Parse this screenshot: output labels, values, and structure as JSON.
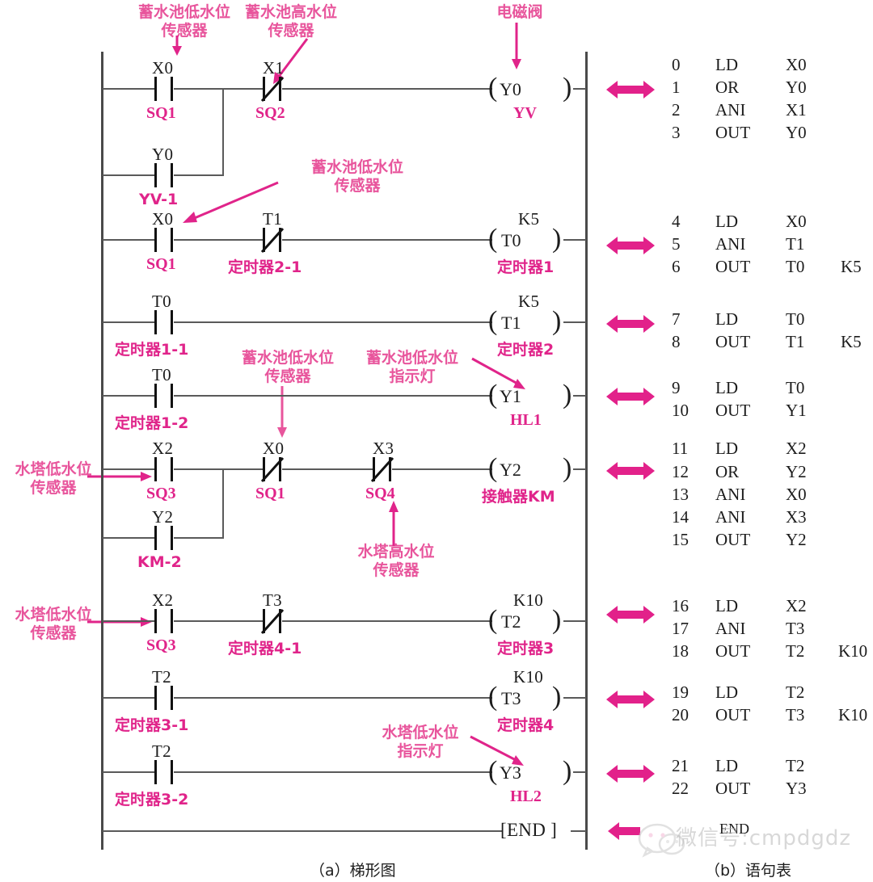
{
  "figure": {
    "caption_a": "（a）梯形图",
    "caption_b": "（b）语句表"
  },
  "annotations": [
    {
      "id": "ann-cistern-low-1",
      "text_l1": "蓄水池低水位",
      "text_l2": "传感器",
      "target": "X0 (rung1)"
    },
    {
      "id": "ann-cistern-high",
      "text_l1": "蓄水池高水位",
      "text_l2": "传感器",
      "target": "X1 (rung1)"
    },
    {
      "id": "ann-solenoid",
      "text_l1": "电磁阀",
      "text_l2": "",
      "target": "Y0 coil"
    },
    {
      "id": "ann-cistern-low-2",
      "text_l1": "蓄水池低水位",
      "text_l2": "传感器",
      "target": "X0 (rung2)"
    },
    {
      "id": "ann-cistern-low-3",
      "text_l1": "蓄水池低水位",
      "text_l2": "传感器",
      "target": "X0 (rung5)"
    },
    {
      "id": "ann-cistern-low-lamp",
      "text_l1": "蓄水池低水位",
      "text_l2": "指示灯",
      "target": "Y1 coil"
    },
    {
      "id": "ann-tower-low-1",
      "text_l1": "水塔低水位",
      "text_l2": "传感器",
      "target": "X2 (rung5)"
    },
    {
      "id": "ann-tower-high",
      "text_l1": "水塔高水位",
      "text_l2": "传感器",
      "target": "X3 (rung5)"
    },
    {
      "id": "ann-tower-low-2",
      "text_l1": "水塔低水位",
      "text_l2": "传感器",
      "target": "X2 (rung6)"
    },
    {
      "id": "ann-tower-low-lamp",
      "text_l1": "水塔低水位",
      "text_l2": "指示灯",
      "target": "Y3 coil"
    }
  ],
  "ladder": {
    "rungs": [
      {
        "id": "rung-1",
        "branches": [
          {
            "contacts": [
              {
                "device": "X0",
                "tag": "SQ1",
                "type": "no"
              }
            ]
          },
          {
            "contacts": [
              {
                "device": "Y0",
                "tag": "YV-1",
                "type": "no"
              }
            ]
          }
        ],
        "series_after_branch": [
          {
            "device": "X1",
            "tag": "SQ2",
            "type": "nc"
          }
        ],
        "coil": {
          "device": "Y0",
          "tag": "YV",
          "preset": "",
          "kind": "coil"
        }
      },
      {
        "id": "rung-2",
        "branches": [],
        "series_after_branch": [
          {
            "device": "X0",
            "tag": "SQ1",
            "type": "no"
          },
          {
            "device": "T1",
            "tag": "定时器2-1",
            "type": "nc"
          }
        ],
        "coil": {
          "device": "T0",
          "tag": "定时器1",
          "preset": "K5",
          "kind": "timer"
        }
      },
      {
        "id": "rung-3",
        "branches": [],
        "series_after_branch": [
          {
            "device": "T0",
            "tag": "定时器1-1",
            "type": "no"
          }
        ],
        "coil": {
          "device": "T1",
          "tag": "定时器2",
          "preset": "K5",
          "kind": "timer"
        }
      },
      {
        "id": "rung-4",
        "branches": [],
        "series_after_branch": [
          {
            "device": "T0",
            "tag": "定时器1-2",
            "type": "no"
          }
        ],
        "coil": {
          "device": "Y1",
          "tag": "HL1",
          "preset": "",
          "kind": "coil"
        }
      },
      {
        "id": "rung-5",
        "branches": [
          {
            "contacts": [
              {
                "device": "X2",
                "tag": "SQ3",
                "type": "no"
              }
            ]
          },
          {
            "contacts": [
              {
                "device": "Y2",
                "tag": "KM-2",
                "type": "no"
              }
            ]
          }
        ],
        "series_after_branch": [
          {
            "device": "X0",
            "tag": "SQ1",
            "type": "nc"
          },
          {
            "device": "X3",
            "tag": "SQ4",
            "type": "nc"
          }
        ],
        "coil": {
          "device": "Y2",
          "tag": "接触器KM",
          "preset": "",
          "kind": "coil"
        }
      },
      {
        "id": "rung-6",
        "branches": [],
        "series_after_branch": [
          {
            "device": "X2",
            "tag": "SQ3",
            "type": "no"
          },
          {
            "device": "T3",
            "tag": "定时器4-1",
            "type": "nc"
          }
        ],
        "coil": {
          "device": "T2",
          "tag": "定时器3",
          "preset": "K10",
          "kind": "timer"
        }
      },
      {
        "id": "rung-7",
        "branches": [],
        "series_after_branch": [
          {
            "device": "T2",
            "tag": "定时器3-1",
            "type": "no"
          }
        ],
        "coil": {
          "device": "T3",
          "tag": "定时器4",
          "preset": "K10",
          "kind": "timer"
        }
      },
      {
        "id": "rung-8",
        "branches": [],
        "series_after_branch": [
          {
            "device": "T2",
            "tag": "定时器3-2",
            "type": "no"
          }
        ],
        "coil": {
          "device": "Y3",
          "tag": "HL2",
          "preset": "",
          "kind": "coil"
        }
      }
    ],
    "end_block": "[END ]"
  },
  "statement_list": {
    "groups": [
      {
        "id": "grp-1",
        "rows": [
          {
            "step": "0",
            "instr": "LD",
            "operand": "X0",
            "preset": ""
          },
          {
            "step": "1",
            "instr": "OR",
            "operand": "Y0",
            "preset": ""
          },
          {
            "step": "2",
            "instr": "ANI",
            "operand": "X1",
            "preset": ""
          },
          {
            "step": "3",
            "instr": "OUT",
            "operand": "Y0",
            "preset": ""
          }
        ]
      },
      {
        "id": "grp-2",
        "rows": [
          {
            "step": "4",
            "instr": "LD",
            "operand": "X0",
            "preset": ""
          },
          {
            "step": "5",
            "instr": "ANI",
            "operand": "T1",
            "preset": ""
          },
          {
            "step": "6",
            "instr": "OUT",
            "operand": "T0",
            "preset": "K5"
          }
        ]
      },
      {
        "id": "grp-3",
        "rows": [
          {
            "step": "7",
            "instr": "LD",
            "operand": "T0",
            "preset": ""
          },
          {
            "step": "8",
            "instr": "OUT",
            "operand": "T1",
            "preset": "K5"
          }
        ]
      },
      {
        "id": "grp-4",
        "rows": [
          {
            "step": "9",
            "instr": "LD",
            "operand": "T0",
            "preset": ""
          },
          {
            "step": "10",
            "instr": "OUT",
            "operand": "Y1",
            "preset": ""
          }
        ]
      },
      {
        "id": "grp-5",
        "rows": [
          {
            "step": "11",
            "instr": "LD",
            "operand": "X2",
            "preset": ""
          },
          {
            "step": "12",
            "instr": "OR",
            "operand": "Y2",
            "preset": ""
          },
          {
            "step": "13",
            "instr": "ANI",
            "operand": "X0",
            "preset": ""
          },
          {
            "step": "14",
            "instr": "ANI",
            "operand": "X3",
            "preset": ""
          },
          {
            "step": "15",
            "instr": "OUT",
            "operand": "Y2",
            "preset": ""
          }
        ]
      },
      {
        "id": "grp-6",
        "rows": [
          {
            "step": "16",
            "instr": "LD",
            "operand": "X2",
            "preset": ""
          },
          {
            "step": "17",
            "instr": "ANI",
            "operand": "T3",
            "preset": ""
          },
          {
            "step": "18",
            "instr": "OUT",
            "operand": "T2",
            "preset": "K10"
          }
        ]
      },
      {
        "id": "grp-7",
        "rows": [
          {
            "step": "19",
            "instr": "LD",
            "operand": "T2",
            "preset": ""
          },
          {
            "step": "20",
            "instr": "OUT",
            "operand": "T3",
            "preset": "K10"
          }
        ]
      },
      {
        "id": "grp-8",
        "rows": [
          {
            "step": "21",
            "instr": "LD",
            "operand": "T2",
            "preset": ""
          },
          {
            "step": "22",
            "instr": "OUT",
            "operand": "Y3",
            "preset": ""
          }
        ]
      },
      {
        "id": "grp-end",
        "rows": [
          {
            "step": "",
            "instr": "END",
            "operand": "",
            "preset": ""
          }
        ]
      }
    ]
  },
  "watermark": {
    "text": "微信号:cmpdgdz"
  },
  "colors": {
    "pink": "#e0248a",
    "pink_light": "#e8559c",
    "line": "#4a4a4a",
    "text": "#1c1c1c"
  }
}
